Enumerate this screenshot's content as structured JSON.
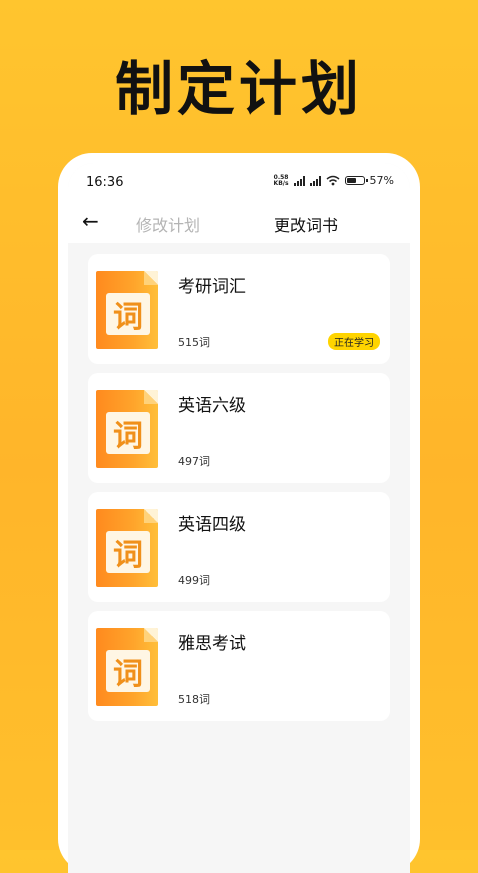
{
  "headline": "制定计划",
  "status_bar": {
    "time": "16:36",
    "net_speed_top": "0.58",
    "net_speed_bottom": "KB/s",
    "battery": "57%"
  },
  "nav": {
    "back_icon": "arrow-left-icon",
    "tab_modify": "修改计划",
    "tab_change": "更改词书"
  },
  "books": [
    {
      "icon_char": "词",
      "title": "考研词汇",
      "count": "515词",
      "badge": "正在学习"
    },
    {
      "icon_char": "词",
      "title": "英语六级",
      "count": "497词",
      "badge": ""
    },
    {
      "icon_char": "词",
      "title": "英语四级",
      "count": "499词",
      "badge": ""
    },
    {
      "icon_char": "词",
      "title": "雅思考试",
      "count": "518词",
      "badge": ""
    }
  ]
}
